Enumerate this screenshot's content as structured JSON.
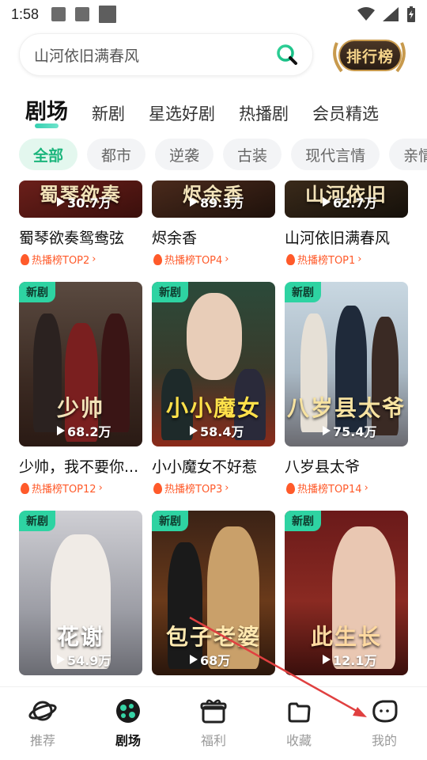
{
  "status": {
    "time": "1:58"
  },
  "search": {
    "placeholder": "山河依旧满春风"
  },
  "rank_badge": {
    "label": "排行榜"
  },
  "top_tabs": [
    {
      "label": "剧场",
      "active": true
    },
    {
      "label": "新剧"
    },
    {
      "label": "星选好剧"
    },
    {
      "label": "热播剧"
    },
    {
      "label": "会员精选"
    }
  ],
  "chips": [
    {
      "label": "全部",
      "active": true
    },
    {
      "label": "都市"
    },
    {
      "label": "逆袭"
    },
    {
      "label": "古装"
    },
    {
      "label": "现代言情"
    },
    {
      "label": "亲情"
    }
  ],
  "rows": [
    [
      {
        "title": "蜀琴欲奏鸳鸯弦",
        "views": "30.7万",
        "tag": "热播榜TOP2",
        "art": "蜀琴欲奏",
        "new": false
      },
      {
        "title": "烬余香",
        "views": "89.3万",
        "tag": "热播榜TOP4",
        "art": "烬余香",
        "new": false
      },
      {
        "title": "山河依旧满春风",
        "views": "62.7万",
        "tag": "热播榜TOP1",
        "art": "山河依旧",
        "new": false
      }
    ],
    [
      {
        "title": "少帅，我不要你...",
        "views": "68.2万",
        "tag": "热播榜TOP12",
        "art": "少帅",
        "new": true
      },
      {
        "title": "小小魔女不好惹",
        "views": "58.4万",
        "tag": "热播榜TOP3",
        "art": "小小魔女",
        "new": true
      },
      {
        "title": "八岁县太爷",
        "views": "75.4万",
        "tag": "热播榜TOP14",
        "art": "八岁县太爷",
        "new": true
      }
    ],
    [
      {
        "title": "",
        "views": "54.9万",
        "tag": "",
        "art": "花谢",
        "new": true
      },
      {
        "title": "",
        "views": "68万",
        "tag": "",
        "art": "包子老婆",
        "new": true
      },
      {
        "title": "",
        "views": "12.1万",
        "tag": "",
        "art": "此生长",
        "new": true
      }
    ]
  ],
  "new_badge": "新剧",
  "bottom_nav": [
    {
      "label": "推荐",
      "icon": "planet-icon"
    },
    {
      "label": "剧场",
      "icon": "theater-icon",
      "active": true
    },
    {
      "label": "福利",
      "icon": "gift-icon"
    },
    {
      "label": "收藏",
      "icon": "bookmark-icon"
    },
    {
      "label": "我的",
      "icon": "profile-face-icon"
    }
  ],
  "colors": {
    "accent": "#2ed3a2",
    "hot": "#ff5a2a",
    "annotation_arrow": "#e04040"
  }
}
